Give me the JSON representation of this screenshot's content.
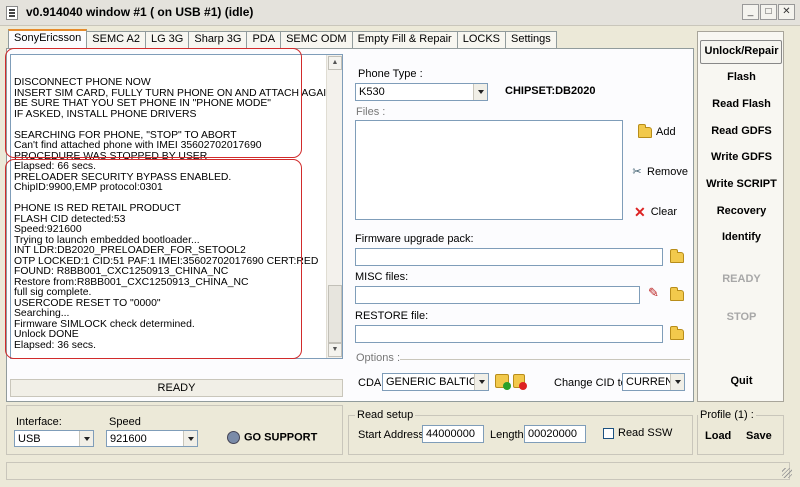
{
  "window": {
    "title": "v0.914040 window #1 ( on USB #1) (idle)",
    "controls": {
      "minimize": "_",
      "maximize": "□",
      "close": "✕"
    }
  },
  "tabs": [
    {
      "label": "SonyEricsson",
      "active": true
    },
    {
      "label": "SEMC A2"
    },
    {
      "label": "LG 3G"
    },
    {
      "label": "Sharp 3G"
    },
    {
      "label": "PDA"
    },
    {
      "label": "SEMC ODM"
    },
    {
      "label": "Empty Fill & Repair"
    },
    {
      "label": "LOCKS"
    },
    {
      "label": "Settings"
    }
  ],
  "log": {
    "block1": [
      "DISCONNECT PHONE NOW",
      "INSERT SIM CARD, FULLY TURN PHONE ON AND ATTACH AGAIN",
      "BE SURE THAT YOU SET PHONE IN \"PHONE MODE\"",
      "IF ASKED, INSTALL PHONE DRIVERS",
      "",
      "SEARCHING FOR PHONE, \"STOP\" TO ABORT",
      "Can't find attached phone with IMEI 35602702017690",
      "PROCEDURE WAS STOPPED BY USER",
      "Elapsed: 66 secs."
    ],
    "block2": [
      "PRELOADER SECURITY BYPASS ENABLED.",
      "ChipID:9900,EMP protocol:0301",
      "",
      "PHONE IS RED RETAIL PRODUCT",
      "FLASH CID detected:53",
      "Speed:921600",
      "Trying to launch embedded bootloader...",
      "INT LDR:DB2020_PRELOADER_FOR_SETOOL2",
      "OTP LOCKED:1 CID:51 PAF:1 IMEI:35602702017690 CERT:RED",
      "FOUND: R8BB001_CXC1250913_CHINA_NC",
      "Restore from:R8BB001_CXC1250913_CHINA_NC",
      "full sig complete.",
      "USERCODE RESET TO \"0000\"",
      "Searching...",
      "Firmware SIMLOCK check determined.",
      "Unlock DONE",
      "Elapsed: 36 secs."
    ]
  },
  "status": "READY",
  "phone_type": {
    "label": "Phone Type :",
    "value": "K530",
    "chipset": "CHIPSET:DB2020"
  },
  "files": {
    "label": "Files :",
    "add": "Add",
    "remove": "Remove",
    "clear": "Clear"
  },
  "firmware": {
    "label": "Firmware upgrade pack:",
    "value": ""
  },
  "misc": {
    "label": "MISC files:",
    "value": ""
  },
  "restore": {
    "label": "RESTORE file:",
    "value": ""
  },
  "options": {
    "label": "Options :",
    "cda_label": "CDA",
    "cda_value": "GENERIC BALTIC  /E",
    "change_cid_label": "Change CID to",
    "change_cid_value": "CURRENT"
  },
  "right_panel": {
    "unlock_repair": "Unlock/Repair",
    "flash": "Flash",
    "read_flash": "Read Flash",
    "read_gdfs": "Read GDFS",
    "write_gdfs": "Write GDFS",
    "write_script": "Write SCRIPT",
    "recovery": "Recovery",
    "identify": "Identify",
    "ready": "READY",
    "stop": "STOP",
    "quit": "Quit"
  },
  "connection": {
    "interface_label": "Interface:",
    "interface_value": "USB",
    "speed_label": "Speed",
    "speed_value": "921600",
    "go_support": "GO SUPPORT"
  },
  "read_setup": {
    "title": "Read setup",
    "start_label": "Start Address:",
    "start_value": "44000000",
    "length_label": "Length:",
    "length_value": "00020000",
    "read_ssw": "Read SSW"
  },
  "profile": {
    "title": "Profile (1) :",
    "load": "Load",
    "save": "Save"
  },
  "colors": {
    "highlight": "#d12b2b",
    "tab_accent": "#e68b2c",
    "field_border": "#7f9db9"
  }
}
